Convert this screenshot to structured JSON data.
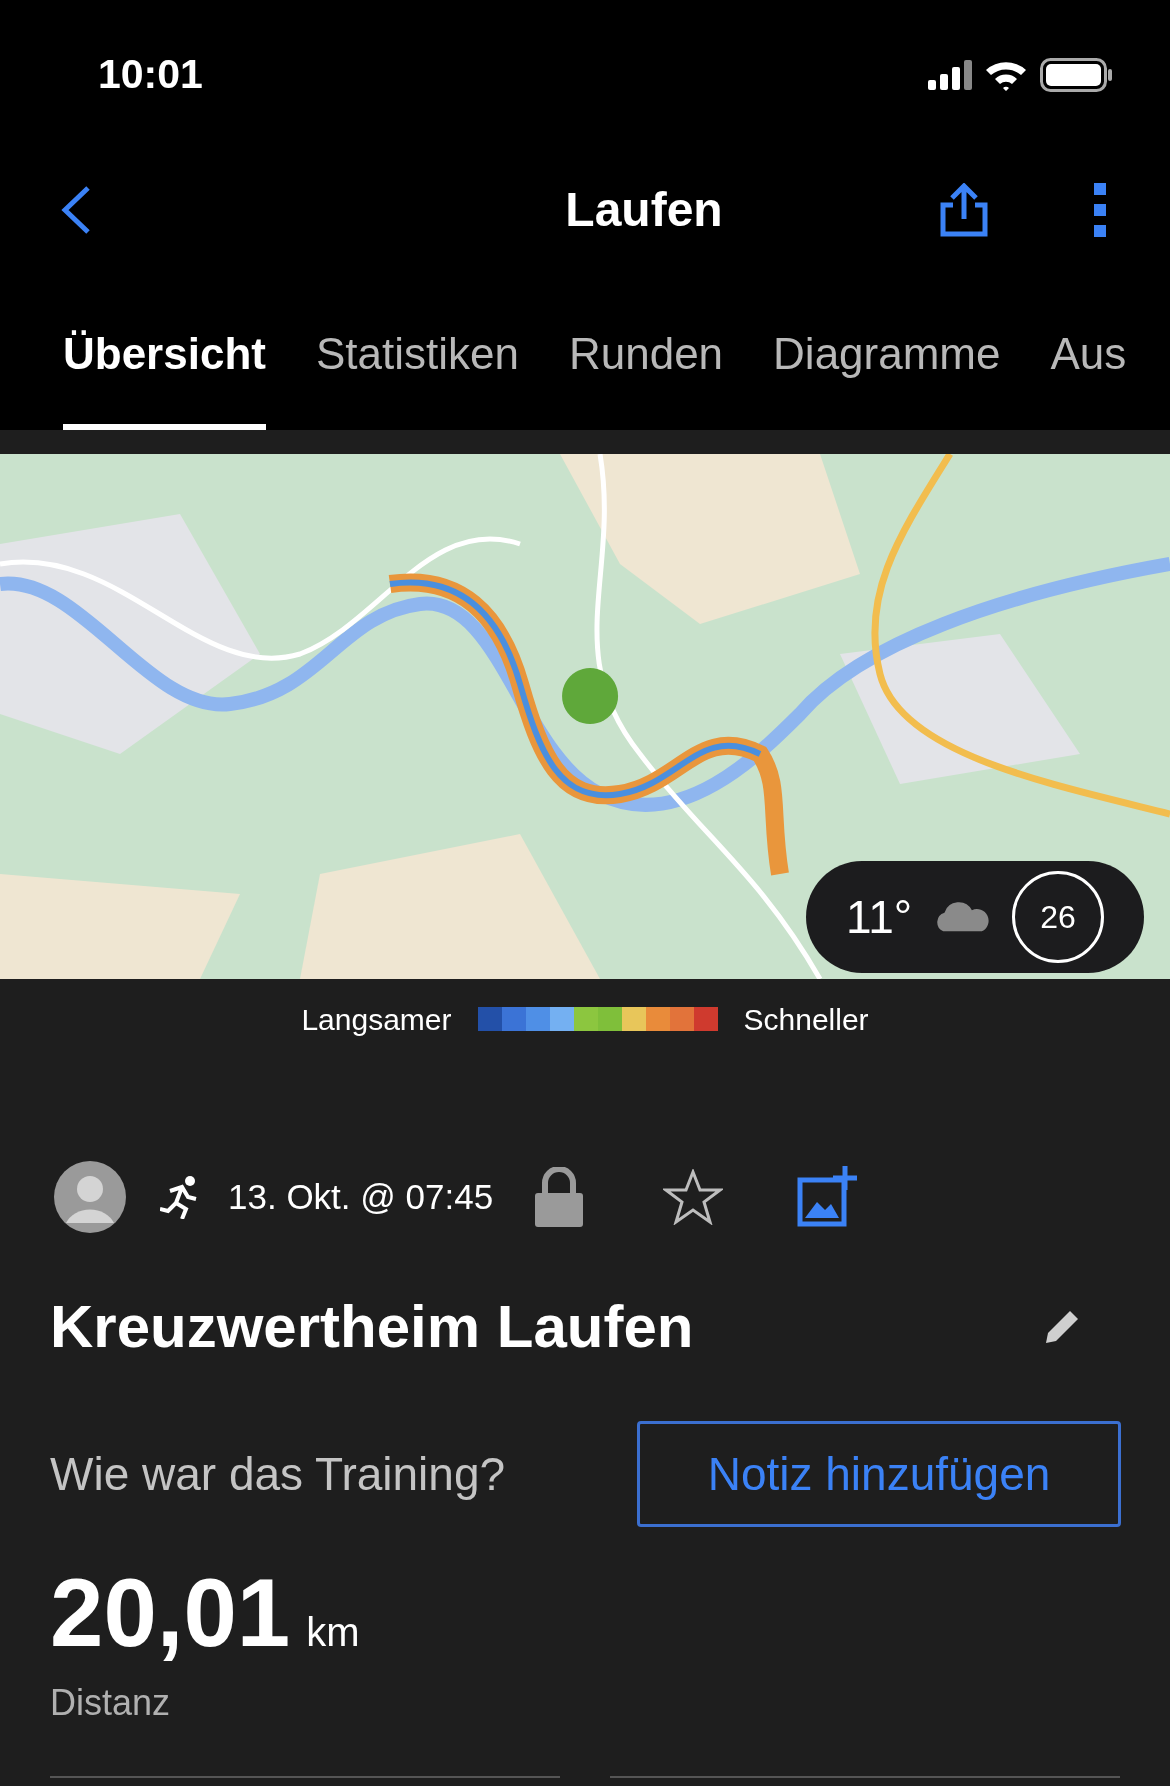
{
  "status_bar": {
    "time": "10:01"
  },
  "header": {
    "title": "Laufen"
  },
  "tabs": [
    {
      "label": "Übersicht",
      "selected": true
    },
    {
      "label": "Statistiken",
      "selected": false
    },
    {
      "label": "Runden",
      "selected": false
    },
    {
      "label": "Diagramme",
      "selected": false
    },
    {
      "label": "Aus",
      "selected": false
    }
  ],
  "map": {
    "kind": "picture",
    "weather": {
      "temperature": "11°",
      "wind": "26"
    }
  },
  "legend": {
    "slower": "Langsamer",
    "faster": "Schneller",
    "scale": [
      {
        "color": "#2350a8"
      },
      {
        "color": "#3b73d6"
      },
      {
        "color": "#4f8fe6"
      },
      {
        "color": "#74b0f2"
      },
      {
        "color": "#8cc63f"
      },
      {
        "color": "#7fbf3a"
      },
      {
        "color": "#e8c65a"
      },
      {
        "color": "#e98b3a"
      },
      {
        "color": "#e2733a"
      },
      {
        "color": "#cf3a2e"
      }
    ]
  },
  "activity": {
    "date": "13. Okt. @ 07:45",
    "private": true,
    "favorite": false,
    "title": "Kreuzwertheim Laufen"
  },
  "note": {
    "prompt": "Wie war das Training?",
    "button": "Notiz hinzufügen"
  },
  "stats": [
    {
      "value": "20,01",
      "unit": "km",
      "label": "Distanz"
    }
  ]
}
